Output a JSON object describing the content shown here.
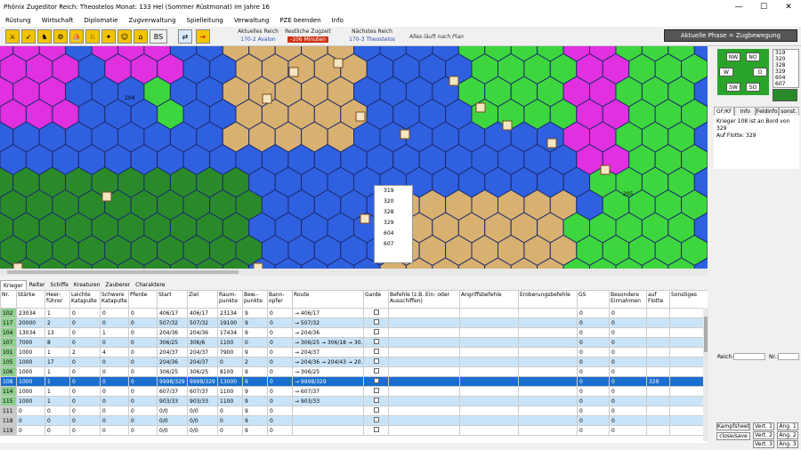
{
  "window": {
    "title": "Phönix Zugeditor Reich: Theostelos Monat: 133 Hel (Sommer Rüstmonat) im Jahre 16",
    "controls": [
      "—",
      "☐",
      "✕"
    ]
  },
  "menu": [
    "Rüstung",
    "Wirtschaft",
    "Diplomatie",
    "Zugverwaltung",
    "Spielleitung",
    "Verwaltung",
    "PZE beenden",
    "Info"
  ],
  "toolbar": {
    "buttons": [
      "sword-icon",
      "archer-icon",
      "rider-icon",
      "catapult-icon",
      "ship-icon",
      "creature-icon",
      "wizard-icon",
      "character-icon",
      "building-icon"
    ],
    "bs_label": "BS",
    "current_realm_label": "Aktuelles Reich",
    "current_realm_value": "170-2 Avalon",
    "time_label": "Restliche Zugzeit",
    "time_value": "-106 Minuten",
    "next_realm_label": "Nächstes Reich",
    "next_realm_value": "170-3 Theostelos",
    "status": "Alles läuft nach Plan",
    "phase": "Aktuelle Phase = Zugbewegung"
  },
  "map": {
    "popup_items": [
      "319",
      "320",
      "328",
      "329",
      "604",
      "607"
    ],
    "hex_labels": [
      "204",
      "205"
    ]
  },
  "right_panel": {
    "compass": {
      "nw": "NW",
      "no": "NO",
      "w": "W",
      "o": "O",
      "sw": "SW",
      "so": "SO"
    },
    "fleet_list": [
      "319",
      "320",
      "328",
      "329",
      "604",
      "607"
    ],
    "tabs": [
      "GF/KF",
      "Info",
      "Feldinfo",
      "sonst."
    ],
    "info_line1": "Krieger 108 ist an Bord von",
    "info_line2": "329",
    "info_line3": "Auf Flotte: 329",
    "reich_label": "Reich:",
    "nr_label": "Nr.:",
    "buttons": {
      "kampfsheet": "Kampfsheet",
      "closesave": "close/save",
      "vert1": "Vert. 1",
      "vert2": "Vert. 2",
      "vert3": "Vert. 3",
      "ang1": "Ang. 1",
      "ang2": "Ang. 2",
      "ang3": "Ang. 3"
    }
  },
  "tabs": [
    "Krieger",
    "Reiter",
    "Schiffe",
    "Kreaturen",
    "Zauberer",
    "Charaktere"
  ],
  "table": {
    "headers": [
      "Nr.",
      "Stärke",
      "Heer-führer",
      "Leichte Katapulte",
      "Schwere Katapulte",
      "Pferde",
      "Start",
      "Ziel",
      "Raum-punkte",
      "Bew.-punkte",
      "Bann-opfer",
      "Route",
      "Garde",
      "Befehle (z.B. Ein- oder Ausschiffen)",
      "Angriffsbefehle",
      "Eroberungsbefehle",
      "GS",
      "Besondere Einnahmen",
      "auf Flotte",
      "Sonstiges"
    ],
    "rows": [
      [
        "102",
        "23034",
        "1",
        "0",
        "0",
        "0",
        "406/17",
        "406/17",
        "23134",
        "9",
        "0",
        "→ 406/17",
        "",
        "",
        "",
        "",
        "0",
        "0",
        "",
        ""
      ],
      [
        "117",
        "20000",
        "2",
        "0",
        "0",
        "0",
        "507/32",
        "507/32",
        "19100",
        "9",
        "0",
        "→ 507/32",
        "",
        "",
        "",
        "",
        "0",
        "0",
        "",
        ""
      ],
      [
        "104",
        "13034",
        "13",
        "0",
        "1",
        "0",
        "204/36",
        "204/36",
        "17434",
        "9",
        "0",
        "→ 204/36",
        "",
        "",
        "",
        "",
        "0",
        "0",
        "",
        ""
      ],
      [
        "107",
        "7000",
        "8",
        "0",
        "0",
        "0",
        "306/25",
        "306/6",
        "1100",
        "0",
        "0",
        "→ 306/25 → 306/18 → 30...",
        "",
        "",
        "",
        "",
        "0",
        "0",
        "",
        ""
      ],
      [
        "101",
        "1000",
        "1",
        "2",
        "4",
        "0",
        "204/37",
        "204/37",
        "7900",
        "9",
        "0",
        "→ 204/37",
        "",
        "",
        "",
        "",
        "0",
        "0",
        "",
        ""
      ],
      [
        "105",
        "1000",
        "17",
        "0",
        "0",
        "0",
        "204/36",
        "204/37",
        "0",
        "2",
        "0",
        "→ 204/36 → 204/43 → 20...",
        "",
        "",
        "",
        "",
        "0",
        "0",
        "",
        ""
      ],
      [
        "106",
        "1000",
        "1",
        "0",
        "0",
        "0",
        "306/25",
        "306/25",
        "8100",
        "9",
        "0",
        "→ 306/25",
        "",
        "",
        "",
        "",
        "0",
        "0",
        "",
        ""
      ],
      [
        "108",
        "1000",
        "1",
        "0",
        "0",
        "0",
        "9998/329",
        "9998/329",
        "13000",
        "9",
        "0",
        "→ 9998/329",
        "",
        "",
        "",
        "",
        "0",
        "0",
        "329",
        ""
      ],
      [
        "114",
        "1000",
        "1",
        "0",
        "0",
        "0",
        "607/37",
        "607/37",
        "1100",
        "9",
        "0",
        "→ 607/37",
        "",
        "",
        "",
        "",
        "0",
        "0",
        "",
        ""
      ],
      [
        "115",
        "1000",
        "1",
        "0",
        "0",
        "0",
        "903/33",
        "903/33",
        "1100",
        "9",
        "0",
        "→ 903/33",
        "",
        "",
        "",
        "",
        "0",
        "0",
        "",
        ""
      ],
      [
        "111",
        "0",
        "0",
        "0",
        "0",
        "0",
        "0/0",
        "0/0",
        "0",
        "9",
        "0",
        "",
        "",
        "",
        "",
        "",
        "0",
        "0",
        "",
        ""
      ],
      [
        "118",
        "0",
        "0",
        "0",
        "0",
        "0",
        "0/0",
        "0/0",
        "0",
        "9",
        "0",
        "",
        "",
        "",
        "",
        "",
        "0",
        "0",
        "",
        ""
      ],
      [
        "119",
        "0",
        "0",
        "0",
        "0",
        "0",
        "0/0",
        "0/0",
        "0",
        "9",
        "0",
        "",
        "",
        "",
        "",
        "",
        "0",
        "0",
        "",
        ""
      ]
    ],
    "selected_row": 7
  },
  "colors": {
    "sea": "#2f60e0",
    "forest": "#2a8a2a",
    "grass": "#3ed63e",
    "magenta": "#e030e0",
    "sand": "#d8b070",
    "selection": "#1a6ed0",
    "toolbar_yellow": "#f5c400"
  }
}
